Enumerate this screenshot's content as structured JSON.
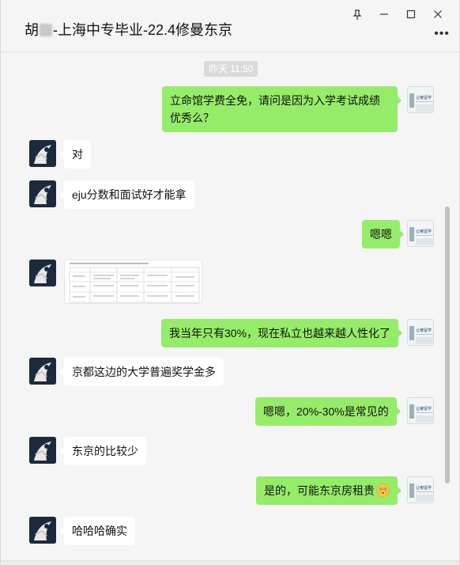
{
  "window": {
    "title_prefix": "胡",
    "title_suffix": "-上海中专毕业-22.4修曼东京",
    "pin_icon": "pin-icon",
    "minimize_icon": "minimize-icon",
    "maximize_icon": "maximize-icon",
    "close_icon": "close-icon",
    "more_icon": "more-icon"
  },
  "chat": {
    "timestamp": "昨天 11:50",
    "messages": [
      {
        "side": "out",
        "text": "立命馆学费全免，请问是因为入学考试成绩优秀么？"
      },
      {
        "side": "in",
        "text": "对"
      },
      {
        "side": "in",
        "text": "eju分数和面试好才能拿"
      },
      {
        "side": "out",
        "text": "嗯嗯"
      },
      {
        "side": "in",
        "type": "image",
        "caption": "table-image"
      },
      {
        "side": "out",
        "text": "我当年只有30%，现在私立也越来越人性化了"
      },
      {
        "side": "in",
        "text": "京都这边的大学普遍奖学金多"
      },
      {
        "side": "out",
        "text": "嗯嗯，20%-30%是常见的"
      },
      {
        "side": "in",
        "text": "东京的比较少"
      },
      {
        "side": "out",
        "text": "是的，可能东京房租贵",
        "emoji": "flushed-face-emoji"
      },
      {
        "side": "in",
        "text": "哈哈哈确实"
      }
    ]
  },
  "colors": {
    "outgoing_bubble": "#95ec69",
    "incoming_bubble": "#ffffff",
    "background": "#f5f5f5"
  }
}
